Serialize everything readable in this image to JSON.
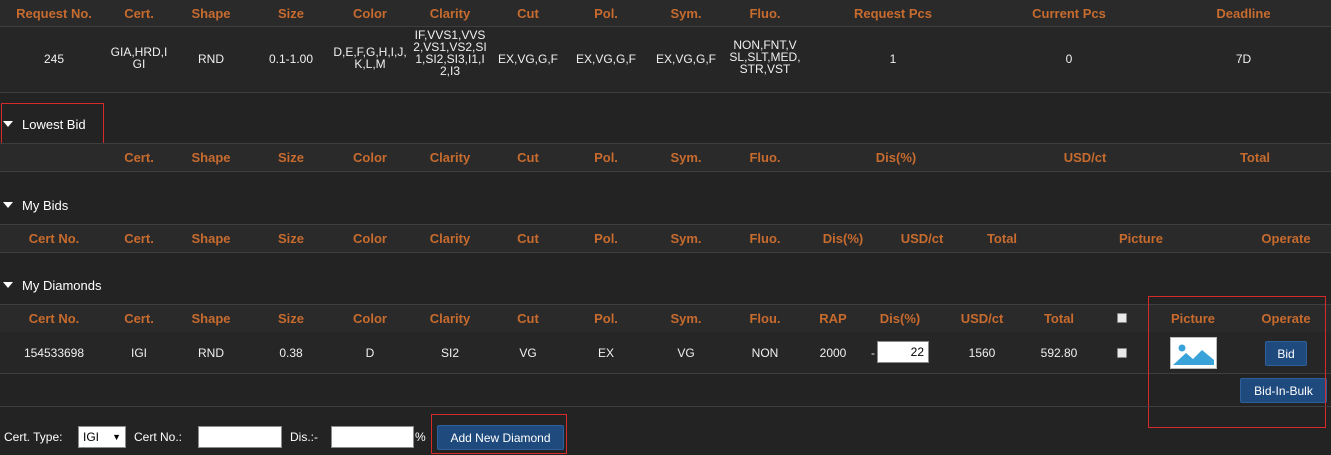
{
  "request": {
    "headers": [
      "Request No.",
      "Cert.",
      "Shape",
      "Size",
      "Color",
      "Clarity",
      "Cut",
      "Pol.",
      "Sym.",
      "Fluo.",
      "Request Pcs",
      "Current Pcs",
      "Deadline"
    ],
    "row": {
      "request_no": "245",
      "cert": [
        "GIA,HRD,I",
        "GI"
      ],
      "shape": "RND",
      "size": "0.1-1.00",
      "color": [
        "D,E,F,G,H,I,J,",
        "K,L,M"
      ],
      "clarity": [
        "IF,VVS1,VVS",
        "2,VS1,VS2,SI",
        "1,SI2,SI3,I1,I",
        "2,I3"
      ],
      "cut": "EX,VG,G,F",
      "pol": "EX,VG,G,F",
      "sym": "EX,VG,G,F",
      "fluo": [
        "NON,FNT,V",
        "SL,SLT,MED,",
        "STR,VST"
      ],
      "request_pcs": "1",
      "current_pcs": "0",
      "deadline": "7D"
    }
  },
  "lowest_bid": {
    "title": "Lowest Bid",
    "headers": [
      "Cert.",
      "Shape",
      "Size",
      "Color",
      "Clarity",
      "Cut",
      "Pol.",
      "Sym.",
      "Fluo.",
      "Dis(%)",
      "USD/ct",
      "Total"
    ]
  },
  "my_bids": {
    "title": "My Bids",
    "headers": [
      "Cert No.",
      "Cert.",
      "Shape",
      "Size",
      "Color",
      "Clarity",
      "Cut",
      "Pol.",
      "Sym.",
      "Fluo.",
      "Dis(%)",
      "USD/ct",
      "Total",
      "Picture",
      "Operate"
    ]
  },
  "my_diamonds": {
    "title": "My Diamonds",
    "headers": [
      "Cert No.",
      "Cert.",
      "Shape",
      "Size",
      "Color",
      "Clarity",
      "Cut",
      "Pol.",
      "Sym.",
      "Flou.",
      "RAP",
      "Dis(%)",
      "USD/ct",
      "Total",
      "Picture",
      "Operate"
    ],
    "row": {
      "cert_no": "154533698",
      "cert": "IGI",
      "shape": "RND",
      "size": "0.38",
      "color": "D",
      "clarity": "SI2",
      "cut": "VG",
      "pol": "EX",
      "sym": "VG",
      "fluo": "NON",
      "rap": "2000",
      "dis_sign": "-",
      "dis_value": "22",
      "usd_ct": "1560",
      "total": "592.80",
      "picture_icon": "image-placeholder-icon",
      "bid_label": "Bid"
    },
    "bulk_label": "Bid-In-Bulk"
  },
  "add_form": {
    "cert_type_label": "Cert. Type:",
    "cert_type_value": "IGI",
    "cert_no_label": "Cert No.:",
    "cert_no_value": "",
    "dis_label": "Dis.:-",
    "dis_value": "",
    "percent": "%",
    "add_button": "Add New Diamond"
  },
  "colors": {
    "header_text": "#c76b2e",
    "background": "#232323",
    "button": "#1f4a7e",
    "highlight": "#d42b2b"
  }
}
